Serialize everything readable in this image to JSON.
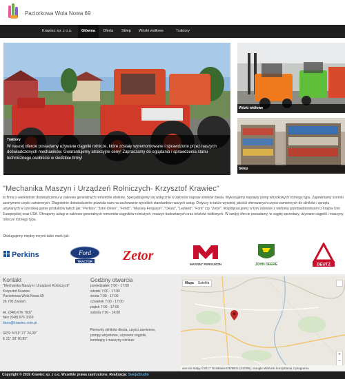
{
  "site": {
    "title": "Paciorkowa Wola Nowa 69"
  },
  "nav": {
    "items": [
      {
        "label": "Krawiec sp. z o.o."
      },
      {
        "label": "Główna"
      },
      {
        "label": "Oferta"
      },
      {
        "label": "Sklep"
      },
      {
        "label": "Wózki widłowe"
      },
      {
        "label": "Traktory"
      }
    ],
    "active_index": 1
  },
  "hero": {
    "main": {
      "title": "Traktory",
      "text": "W naszej ofercie posiadamy używane ciągniki rolnicze, które zostały wyremontowane i sprawdzone przez naszych doświadczonych mechaników. Gwarantujemy atrakcyjne ceny! Zapraszamy do oglądania i sprawdzenia stanu technicznego osobiście w siedzibie firmy!"
    },
    "top_right": {
      "title": "Wózki widłowe"
    },
    "bottom_right": {
      "title": "Sklep"
    }
  },
  "about": {
    "headline": "\"Mechanika Maszyn i Urządzeń Rolniczych- Krzysztof Krawiec\"",
    "text": "to firma o wieloletnim doświadczeniu w zakresie generalnych remontów silników. Specjalizujemy się wyłącznie w zakresie napraw silników diesla. Wykonujemy naprawy pomp wtryskowych różnego typu. Zapewniamy szeroki asortyment części zamiennych. Długoletnie doświadczenie pozwala nam na zachowanie wysokich standardów naszych usług. Dotyczy to także wysokiej jakości oferowanych części zamiennych do silników i sprzętu używanych w szerokiej gamie produktów takich jak: \"Perkins\",\"John Deere\", \"Fendt\", \"Massey Ferguson\", \"Deutz\", \"Leyland\", \"Ford\" czy \"Zetor\". Współpracujemy w tym zakresie z wieloma przedsiębiorstwami z krajów Unii Europejskiej oraz USA. Oferujemy usługi w zakresie generalnych remontów ciągników rolniczych, maszyn budowlanych oraz wózków widłowych. W swojej ofercie posiadamy, w ciągłej sprzedaży, używane ciągniki i maszyny rolnicze różnego typu.",
    "brands_intro": "Obsługujemy między innymi takie marki jak:"
  },
  "brands": [
    {
      "name": "Perkins",
      "color": "#1b4f9c"
    },
    {
      "name": "Ford",
      "sub": "TRACTOR",
      "color": "#1d3b7a"
    },
    {
      "name": "Zetor",
      "color": "#d21f26"
    },
    {
      "name": "MASSEY FERGUSON",
      "color": "#c8102e"
    },
    {
      "name": "JOHN DEERE",
      "color": "#367c2b"
    },
    {
      "name": "DEUTZ",
      "color": "#c8102e"
    }
  ],
  "contact": {
    "title": "Kontakt",
    "lines": [
      "\"Mechanika Maszyn i Urządzeń Rolniczych\"",
      "Krzysztof Krawiec",
      "Paciorkowa Wola Nowa 69",
      "26 700 Zwoleń",
      "",
      "tel. (048) 676 7937",
      "faks (048) 676 3339",
      "biuro@krawiec.com.pl",
      "",
      "GPS: N 51° 27' 24,00\"",
      "E 21° 38' 00,83\""
    ],
    "email_index": 7
  },
  "hours": {
    "title": "Godziny otwarcia",
    "lines": [
      "poniedziałek 7:00 - 17:00",
      "wtorek 7:00 - 17:00",
      "środa 7:00 - 17:00",
      "czwartek 7:00 - 17:00",
      "piątek 7:00 - 17:00",
      "sobota 7:00 - 14:00"
    ],
    "services": [
      "Remonty silników diesla, części zamienne,",
      "pompy wtryskowe, używane ciągniki,",
      "kombajny i maszyny rolnicze"
    ]
  },
  "map": {
    "tabs": [
      "Mapa",
      "Satelita"
    ],
    "active_tab": 0,
    "attribution": "ane do Mapy ©2017 GeoBasis-DE/BKG (©2009), Google   Warunki korzystania z programu",
    "zoom_in": "+",
    "zoom_out": "−"
  },
  "footer": {
    "copyright": "Copyright © 2016 Krawiec sp. z o.o. Wszelkie prawa zastrzeżone. Realizacja: ",
    "credit": "SwojaStudio"
  },
  "colors": {
    "nav_bg": "#1f1f1f",
    "caption_bg": "rgba(0,0,0,0.72)",
    "footer_bg": "#ededed",
    "link": "#2a6db0"
  }
}
